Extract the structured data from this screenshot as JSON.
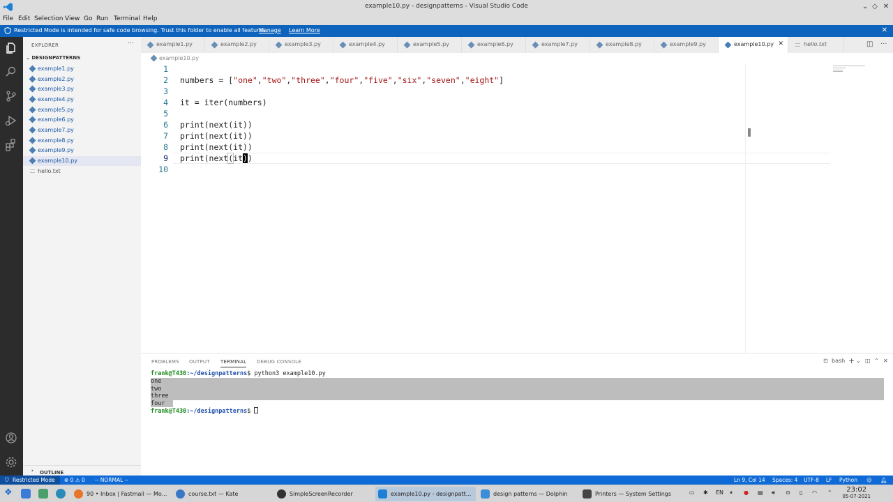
{
  "window": {
    "title": "example10.py - designpatterns - Visual Studio Code"
  },
  "menu": [
    "File",
    "Edit",
    "Selection",
    "View",
    "Go",
    "Run",
    "Terminal",
    "Help"
  ],
  "banner": {
    "text": "Restricted Mode is intended for safe code browsing. Trust this folder to enable all features.",
    "manage": "Manage",
    "learn_more": "Learn More"
  },
  "sidebar": {
    "header": "EXPLORER",
    "folder": "DESIGNPATTERNS",
    "files": [
      "example1.py",
      "example2.py",
      "example3.py",
      "example4.py",
      "example5.py",
      "example6.py",
      "example7.py",
      "example8.py",
      "example9.py",
      "example10.py",
      "hello.txt"
    ],
    "outline": "OUTLINE"
  },
  "tabs": [
    "example1.py",
    "example2.py",
    "example3.py",
    "example4.py",
    "example5.py",
    "example6.py",
    "example7.py",
    "example8.py",
    "example9.py",
    "example10.py",
    "hello.txt"
  ],
  "breadcrumb": "example10.py",
  "editor": {
    "line_numbers": [
      "1",
      "2",
      "3",
      "4",
      "5",
      "6",
      "7",
      "8",
      "9",
      "10"
    ],
    "lines": {
      "l2_pre": "numbers = [",
      "l2_strings": [
        "\"one\"",
        "\"two\"",
        "\"three\"",
        "\"four\"",
        "\"five\"",
        "\"six\"",
        "\"seven\"",
        "\"eight\""
      ],
      "comma": ",",
      "l2_post": "]",
      "l4": "it = iter(numbers)",
      "l6": "print(next(it))",
      "l7": "print(next(it))",
      "l8": "print(next(it))",
      "l9_a": "print(next",
      "l9_b": "(",
      "l9_c": "it",
      "l9_d": ")",
      "l9_e": ")"
    }
  },
  "panel": {
    "tabs": [
      "PROBLEMS",
      "OUTPUT",
      "TERMINAL",
      "DEBUG CONSOLE"
    ],
    "shell": "bash",
    "prompt_user": "frank@T430",
    "prompt_path": ":~/designpatterns",
    "prompt_end": "$ ",
    "command": "python3 example10.py",
    "output": [
      "one",
      "two",
      "three",
      "four"
    ]
  },
  "statusbar": {
    "restricted": "Restricted Mode",
    "errors": "0",
    "warnings": "0",
    "mode": "-- NORMAL --",
    "position": "Ln 9, Col 14",
    "spaces": "Spaces: 4",
    "encoding": "UTF-8",
    "eol": "LF",
    "language": "Python"
  },
  "taskbar": {
    "tasks": [
      "90 • Inbox | Fastmail — Mo...",
      "course.txt — Kate",
      "SimpleScreenRecorder",
      "example10.py - designpatt...",
      "design patterns — Dolphin",
      "Printers — System Settings"
    ],
    "lang": "EN",
    "time": "23:02",
    "date": "05-07-2021"
  },
  "colors": {
    "accent": "#0e6ad6",
    "banner": "#0e63bd",
    "string": "#a31515",
    "line_number": "#237893",
    "prompt_green": "#1a8a1a",
    "prompt_blue": "#1e4fa8"
  }
}
